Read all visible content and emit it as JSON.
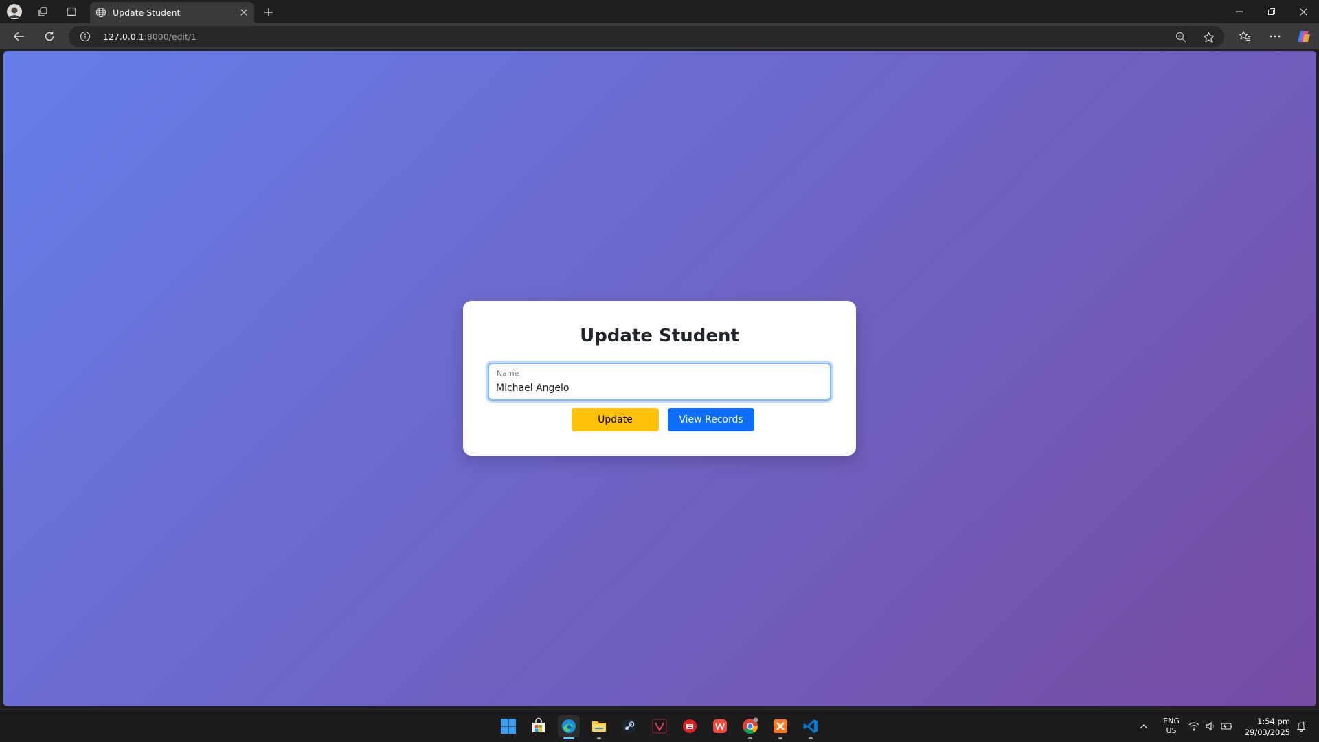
{
  "browser": {
    "tab_title": "Update Student",
    "url_host": "127.0.0.1",
    "url_path": ":8000/edit/1"
  },
  "form": {
    "title": "Update Student",
    "name_label": "Name",
    "name_value": "Michael Angelo",
    "update_label": "Update",
    "view_records_label": "View Records"
  },
  "colors": {
    "gradient_start": "#667eea",
    "gradient_end": "#764ba2",
    "update_button": "#ffc107",
    "view_records_button": "#0d6efd"
  },
  "taskbar": {
    "apps": [
      "windows-start",
      "microsoft-store",
      "edge",
      "file-explorer",
      "steam",
      "vivaldi",
      "pinned-app-red",
      "wps-office",
      "chrome",
      "xampp",
      "vscode"
    ],
    "lang_top": "ENG",
    "lang_bottom": "US",
    "time": "1:54 pm",
    "date": "29/03/2025"
  }
}
